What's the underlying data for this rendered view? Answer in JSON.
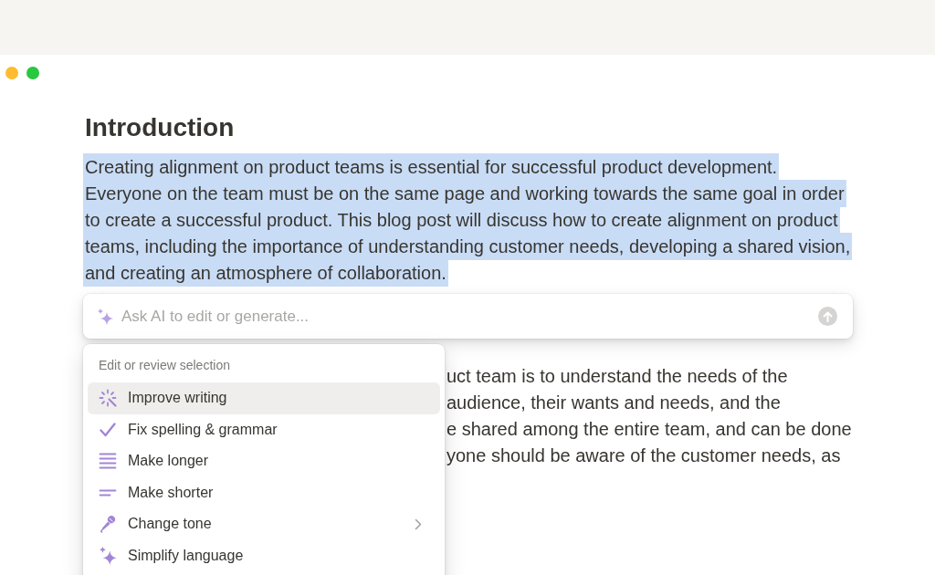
{
  "window_controls": [
    {
      "color": "#febc2e"
    },
    {
      "color": "#28c840"
    }
  ],
  "document": {
    "title_heading": "Introduction",
    "intro": {
      "text": "Creating alignment on product teams is essential for successful product development. Everyone on the team must be on the same page and working towards the same goal in order to create a successful product. This blog post will discuss how to create alignment on product teams, including the importance of understanding customer needs, developing a shared vision, and creating an atmosphere of collaboration.",
      "selected": true
    },
    "section_lines": [
      "uct team is to understand the needs of the",
      "audience, their wants and needs, and the",
      "e shared among the entire team, and can be done",
      "yone should be aware of the customer needs, as"
    ]
  },
  "ai_prompt": {
    "placeholder": "Ask AI to edit or generate..."
  },
  "menu": {
    "heading": "Edit or review selection",
    "items": [
      {
        "label": "Improve writing",
        "kind": "improve",
        "selected": true,
        "has_submenu": false
      },
      {
        "label": "Fix spelling & grammar",
        "kind": "spelling",
        "selected": false,
        "has_submenu": false
      },
      {
        "label": "Make longer",
        "kind": "longer",
        "selected": false,
        "has_submenu": false
      },
      {
        "label": "Make shorter",
        "kind": "shorter",
        "selected": false,
        "has_submenu": false
      },
      {
        "label": "Change tone",
        "kind": "tone",
        "selected": false,
        "has_submenu": true
      },
      {
        "label": "Simplify language",
        "kind": "simplify",
        "selected": false,
        "has_submenu": false
      }
    ]
  }
}
